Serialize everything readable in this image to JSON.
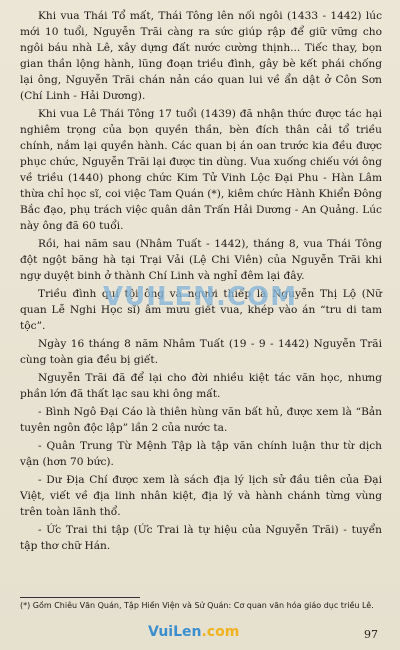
{
  "paragraphs": [
    "Khi vua Thái Tổ mất, Thái Tông lên nối ngôi (1433 - 1442) lúc mới 10 tuổi, Nguyễn Trãi càng ra sức giúp rập để giữ vững cho ngôi báu nhà Lê, xây dựng đất nước cường thịnh... Tiếc thay, bọn gian thần lộng hành, lũng đoạn triều đình, gây bè kết phái chống lại ông, Nguyễn Trãi chán nản cáo quan lui về ẩn dật ở Côn Sơn (Chí Linh - Hải Dương).",
    "Khi vua Lê Thái Tông 17 tuổi (1439) đã nhận thức được tác hại nghiêm trọng của bọn quyền thần, bèn đích thân cải tổ triều chính, nắm lại quyền hành. Các quan bị án oan trước kia đều được phục chức, Nguyễn Trãi lại được tin dùng. Vua xuống chiếu với ông về triều (1440) phong chức Kim Tử Vinh Lộc Đại Phu - Hàn Lâm thừa chỉ học sĩ, coi việc Tam Quán (*), kiêm chức Hành Khiển Đông Bắc đạo, phụ trách việc quân dân Trấn Hải Dương - An Quảng. Lúc này ông đã 60 tuổi.",
    "Rồi, hai năm sau (Nhâm Tuất - 1442), tháng 8, vua Thái Tông đột ngột băng hà tại Trại Vải (Lệ Chi Viên) của Nguyễn Trãi khi ngự duyệt binh ở thành Chí Linh và nghỉ đêm lại đây.",
    "Triều đình qui tội ông và người thiếp là Nguyễn Thị Lộ (Nữ quan Lễ Nghi Học sĩ) âm mưu giết vua, khép vào án “tru di tam tộc”.",
    "Ngày 16 tháng 8 năm Nhâm Tuất (19 - 9 - 1442) Nguyễn Trãi cùng toàn gia đều bị giết.",
    "Nguyễn Trãi đã để lại cho đời nhiều kiệt tác văn học, nhưng phần lớn đã thất lạc sau khi ông mất.",
    "- Bình Ngô Đại Cáo là thiên hùng văn bất hủ, được xem là “Bản tuyên ngôn độc lập” lần 2 của nước ta.",
    "- Quân Trung Từ Mệnh Tập là tập văn chính luận thư từ dịch vận (hơn 70 bức).",
    "- Dư Địa Chí được xem là sách địa lý lịch sử đầu tiên của Đại Việt, viết về địa linh nhân kiệt, địa lý và hành chánh từng vùng trên toàn lãnh thổ.",
    "- Ức Trai thi tập (Ức Trai là tự hiệu của Nguyễn Trãi) - tuyển tập thơ chữ Hán."
  ],
  "watermark": "VUILEN.COM",
  "footnote": "(*) Gồm Chiêu Văn Quán, Tập Hiền Viện và Sử Quán: Cơ quan văn hóa giáo dục triều Lê.",
  "logo": {
    "left": "VuiLen",
    "right": ".com"
  },
  "page_number": "97"
}
